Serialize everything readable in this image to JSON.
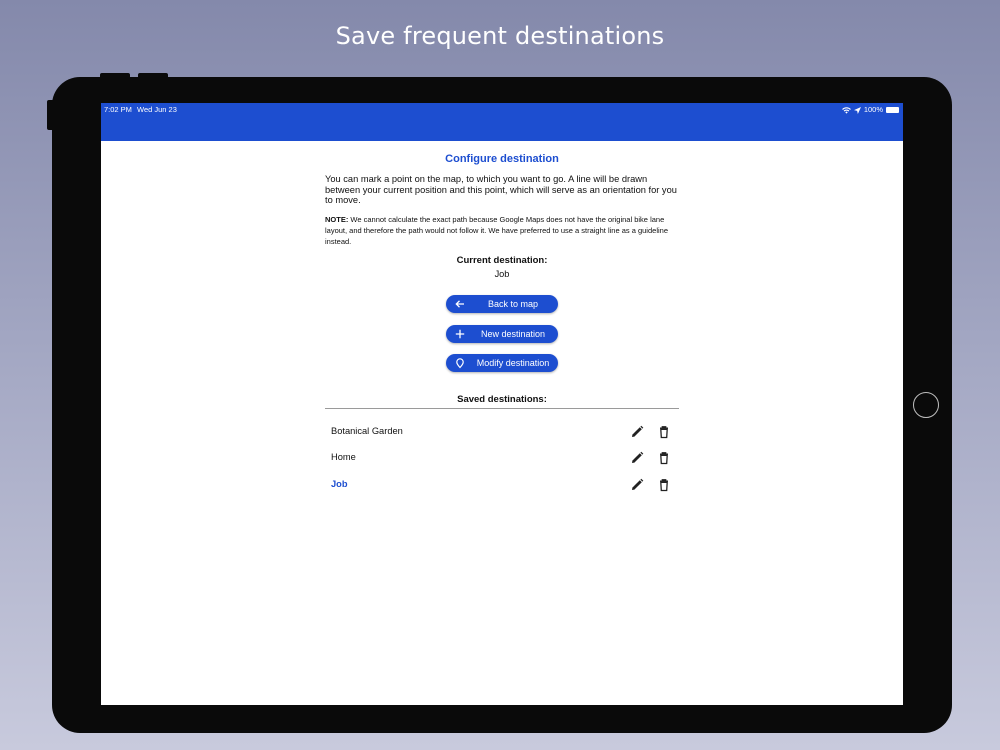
{
  "promo": {
    "caption": "Save frequent destinations"
  },
  "status_bar": {
    "time": "7:02 PM",
    "date": "Wed Jun 23",
    "battery": "100%"
  },
  "page": {
    "title": "Configure destination",
    "intro": "You can mark a point on the map, to which you want to go. A line will be drawn between your current position and this point, which will serve as an orientation for you to move.",
    "note_label": "NOTE:",
    "note_text": " We cannot calculate the exact path because Google Maps does not have the original bike lane layout, and therefore the path would not follow it. We have preferred to use a straight line as a guideline instead.",
    "current_label": "Current destination:",
    "current_value": "Job"
  },
  "actions": {
    "back": {
      "label": "Back to map",
      "icon": "arrow-left-icon"
    },
    "new": {
      "label": "New destination",
      "icon": "plus-icon"
    },
    "modify": {
      "label": "Modify destination",
      "icon": "map-pin-icon"
    }
  },
  "saved": {
    "label": "Saved destinations:",
    "items": [
      {
        "name": "Botanical Garden",
        "active": false
      },
      {
        "name": "Home",
        "active": false
      },
      {
        "name": "Job",
        "active": true
      }
    ]
  },
  "colors": {
    "accent": "#1d4ed0",
    "background_top": "#8489ab",
    "background_bottom": "#c8cadd"
  }
}
